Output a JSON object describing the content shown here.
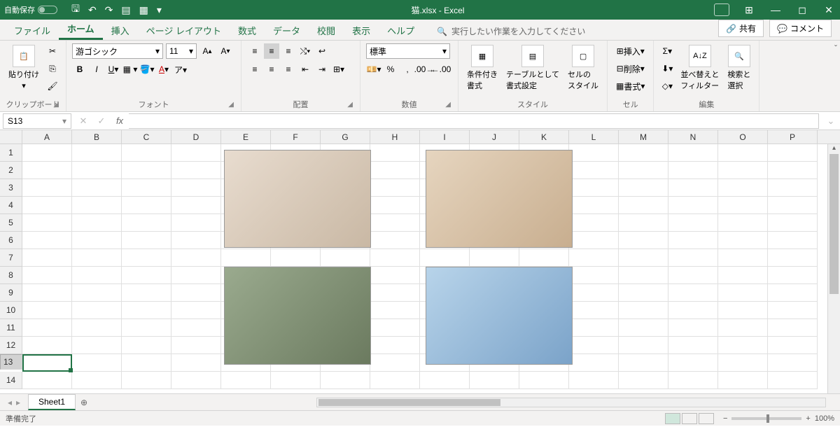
{
  "titlebar": {
    "autosave": "自動保存",
    "autosave_state": "オフ",
    "filename": "猫.xlsx",
    "app": "Excel"
  },
  "tabs": {
    "file": "ファイル",
    "home": "ホーム",
    "insert": "挿入",
    "page_layout": "ページ レイアウト",
    "formulas": "数式",
    "data": "データ",
    "review": "校閲",
    "view": "表示",
    "help": "ヘルプ",
    "search_placeholder": "実行したい作業を入力してください",
    "share": "共有",
    "comments": "コメント"
  },
  "ribbon": {
    "clipboard": {
      "paste": "貼り付け",
      "label": "クリップボード"
    },
    "font": {
      "name": "游ゴシック",
      "size": "11",
      "label": "フォント"
    },
    "alignment": {
      "label": "配置"
    },
    "number": {
      "format": "標準",
      "label": "数値"
    },
    "styles": {
      "cond": "条件付き\n書式",
      "table": "テーブルとして\n書式設定",
      "cell": "セルの\nスタイル",
      "label": "スタイル"
    },
    "cells": {
      "insert": "挿入",
      "delete": "削除",
      "format": "書式",
      "label": "セル"
    },
    "editing": {
      "sort": "並べ替えと\nフィルター",
      "find": "検索と\n選択",
      "label": "編集"
    }
  },
  "formulabar": {
    "cell_ref": "S13"
  },
  "columns": [
    "A",
    "B",
    "C",
    "D",
    "E",
    "F",
    "G",
    "H",
    "I",
    "J",
    "K",
    "L",
    "M",
    "N",
    "O",
    "P"
  ],
  "rows": [
    1,
    2,
    3,
    4,
    5,
    6,
    7,
    8,
    9,
    10,
    11,
    12,
    13,
    14
  ],
  "selected_row": 13,
  "sheets": {
    "sheet1": "Sheet1"
  },
  "status": {
    "ready": "準備完了",
    "zoom": "100%"
  }
}
